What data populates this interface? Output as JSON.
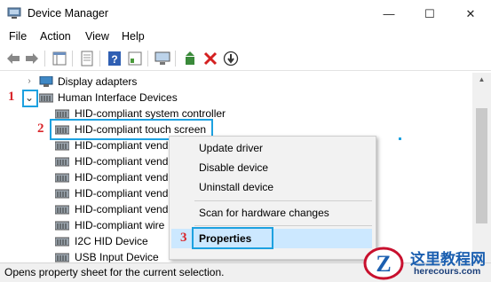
{
  "window": {
    "title": "Device Manager",
    "icon": "device-manager-icon",
    "controls": {
      "minimize": "—",
      "maximize": "☐",
      "close": "✕"
    }
  },
  "menu": [
    "File",
    "Action",
    "View",
    "Help"
  ],
  "toolbar": {
    "icons": [
      "back-arrow-icon",
      "forward-arrow-icon",
      "show-hide-tree-icon",
      "properties-sheet-icon",
      "help-icon",
      "view-icon",
      "monitor-scan-icon",
      "update-driver-icon",
      "uninstall-icon",
      "download-icon"
    ]
  },
  "tree": {
    "display_adapters": {
      "label": "Display adapters",
      "expander": "›"
    },
    "hid_group": {
      "label": "Human Interface Devices",
      "expander": "⌄"
    },
    "children": [
      {
        "label": "HID-compliant system controller"
      },
      {
        "label": "HID-compliant touch screen"
      },
      {
        "label": "HID-compliant vend"
      },
      {
        "label": "HID-compliant vend"
      },
      {
        "label": "HID-compliant vend"
      },
      {
        "label": "HID-compliant vend"
      },
      {
        "label": "HID-compliant vend"
      },
      {
        "label": "HID-compliant wire"
      },
      {
        "label": "I2C HID Device"
      },
      {
        "label": "USB Input Device"
      }
    ]
  },
  "context_menu": {
    "items": [
      "Update driver",
      "Disable device",
      "Uninstall device",
      "Scan for hardware changes",
      "Properties"
    ],
    "highlighted": "Properties"
  },
  "annotations": {
    "step1": "1",
    "step2": "2",
    "step3": "3"
  },
  "status_bar": {
    "text": "Opens property sheet for the current selection."
  },
  "watermark": {
    "chinese": "这里教程网",
    "domain": "herecours.com"
  },
  "colors": {
    "callout": "#1da1e0",
    "step_number": "#d9262b",
    "menu_highlight": "#cce8ff"
  }
}
